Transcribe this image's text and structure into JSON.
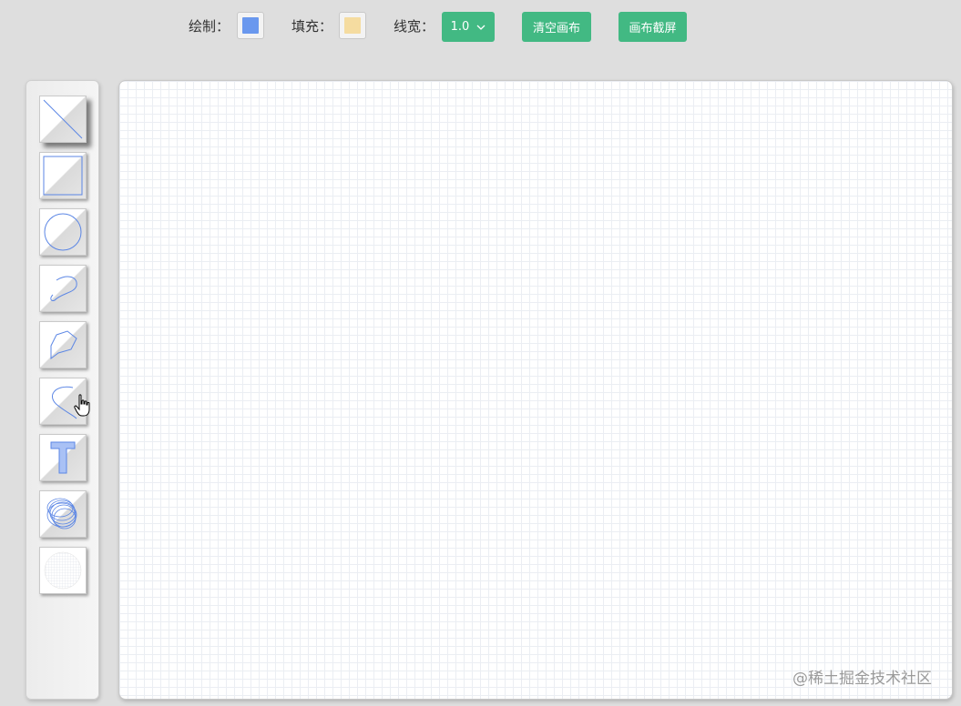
{
  "toolbar": {
    "draw_label": "绘制：",
    "fill_label": "填充：",
    "line_width_label": "线宽：",
    "line_width_value": "1.0",
    "clear_label": "清空画布",
    "screenshot_label": "画布截屏",
    "draw_color": "#6a98ee",
    "fill_color": "#f5dca0",
    "accent_color": "#42b983"
  },
  "tools": [
    {
      "name": "line-tool",
      "icon": "line-icon",
      "active": true
    },
    {
      "name": "rectangle-tool",
      "icon": "rectangle-icon",
      "active": false
    },
    {
      "name": "circle-tool",
      "icon": "circle-icon",
      "active": false
    },
    {
      "name": "freehand-curve-tool",
      "icon": "curve-icon",
      "active": false
    },
    {
      "name": "polygon-tool",
      "icon": "polygon-icon",
      "active": false
    },
    {
      "name": "bezier-tool",
      "icon": "bezier-icon",
      "active": false
    },
    {
      "name": "text-tool",
      "icon": "text-icon",
      "active": false
    },
    {
      "name": "spirograph-tool",
      "icon": "spirograph-icon",
      "active": false
    },
    {
      "name": "eraser-tool",
      "icon": "eraser-icon",
      "active": false
    }
  ],
  "watermark": "@稀土掘金技术社区"
}
